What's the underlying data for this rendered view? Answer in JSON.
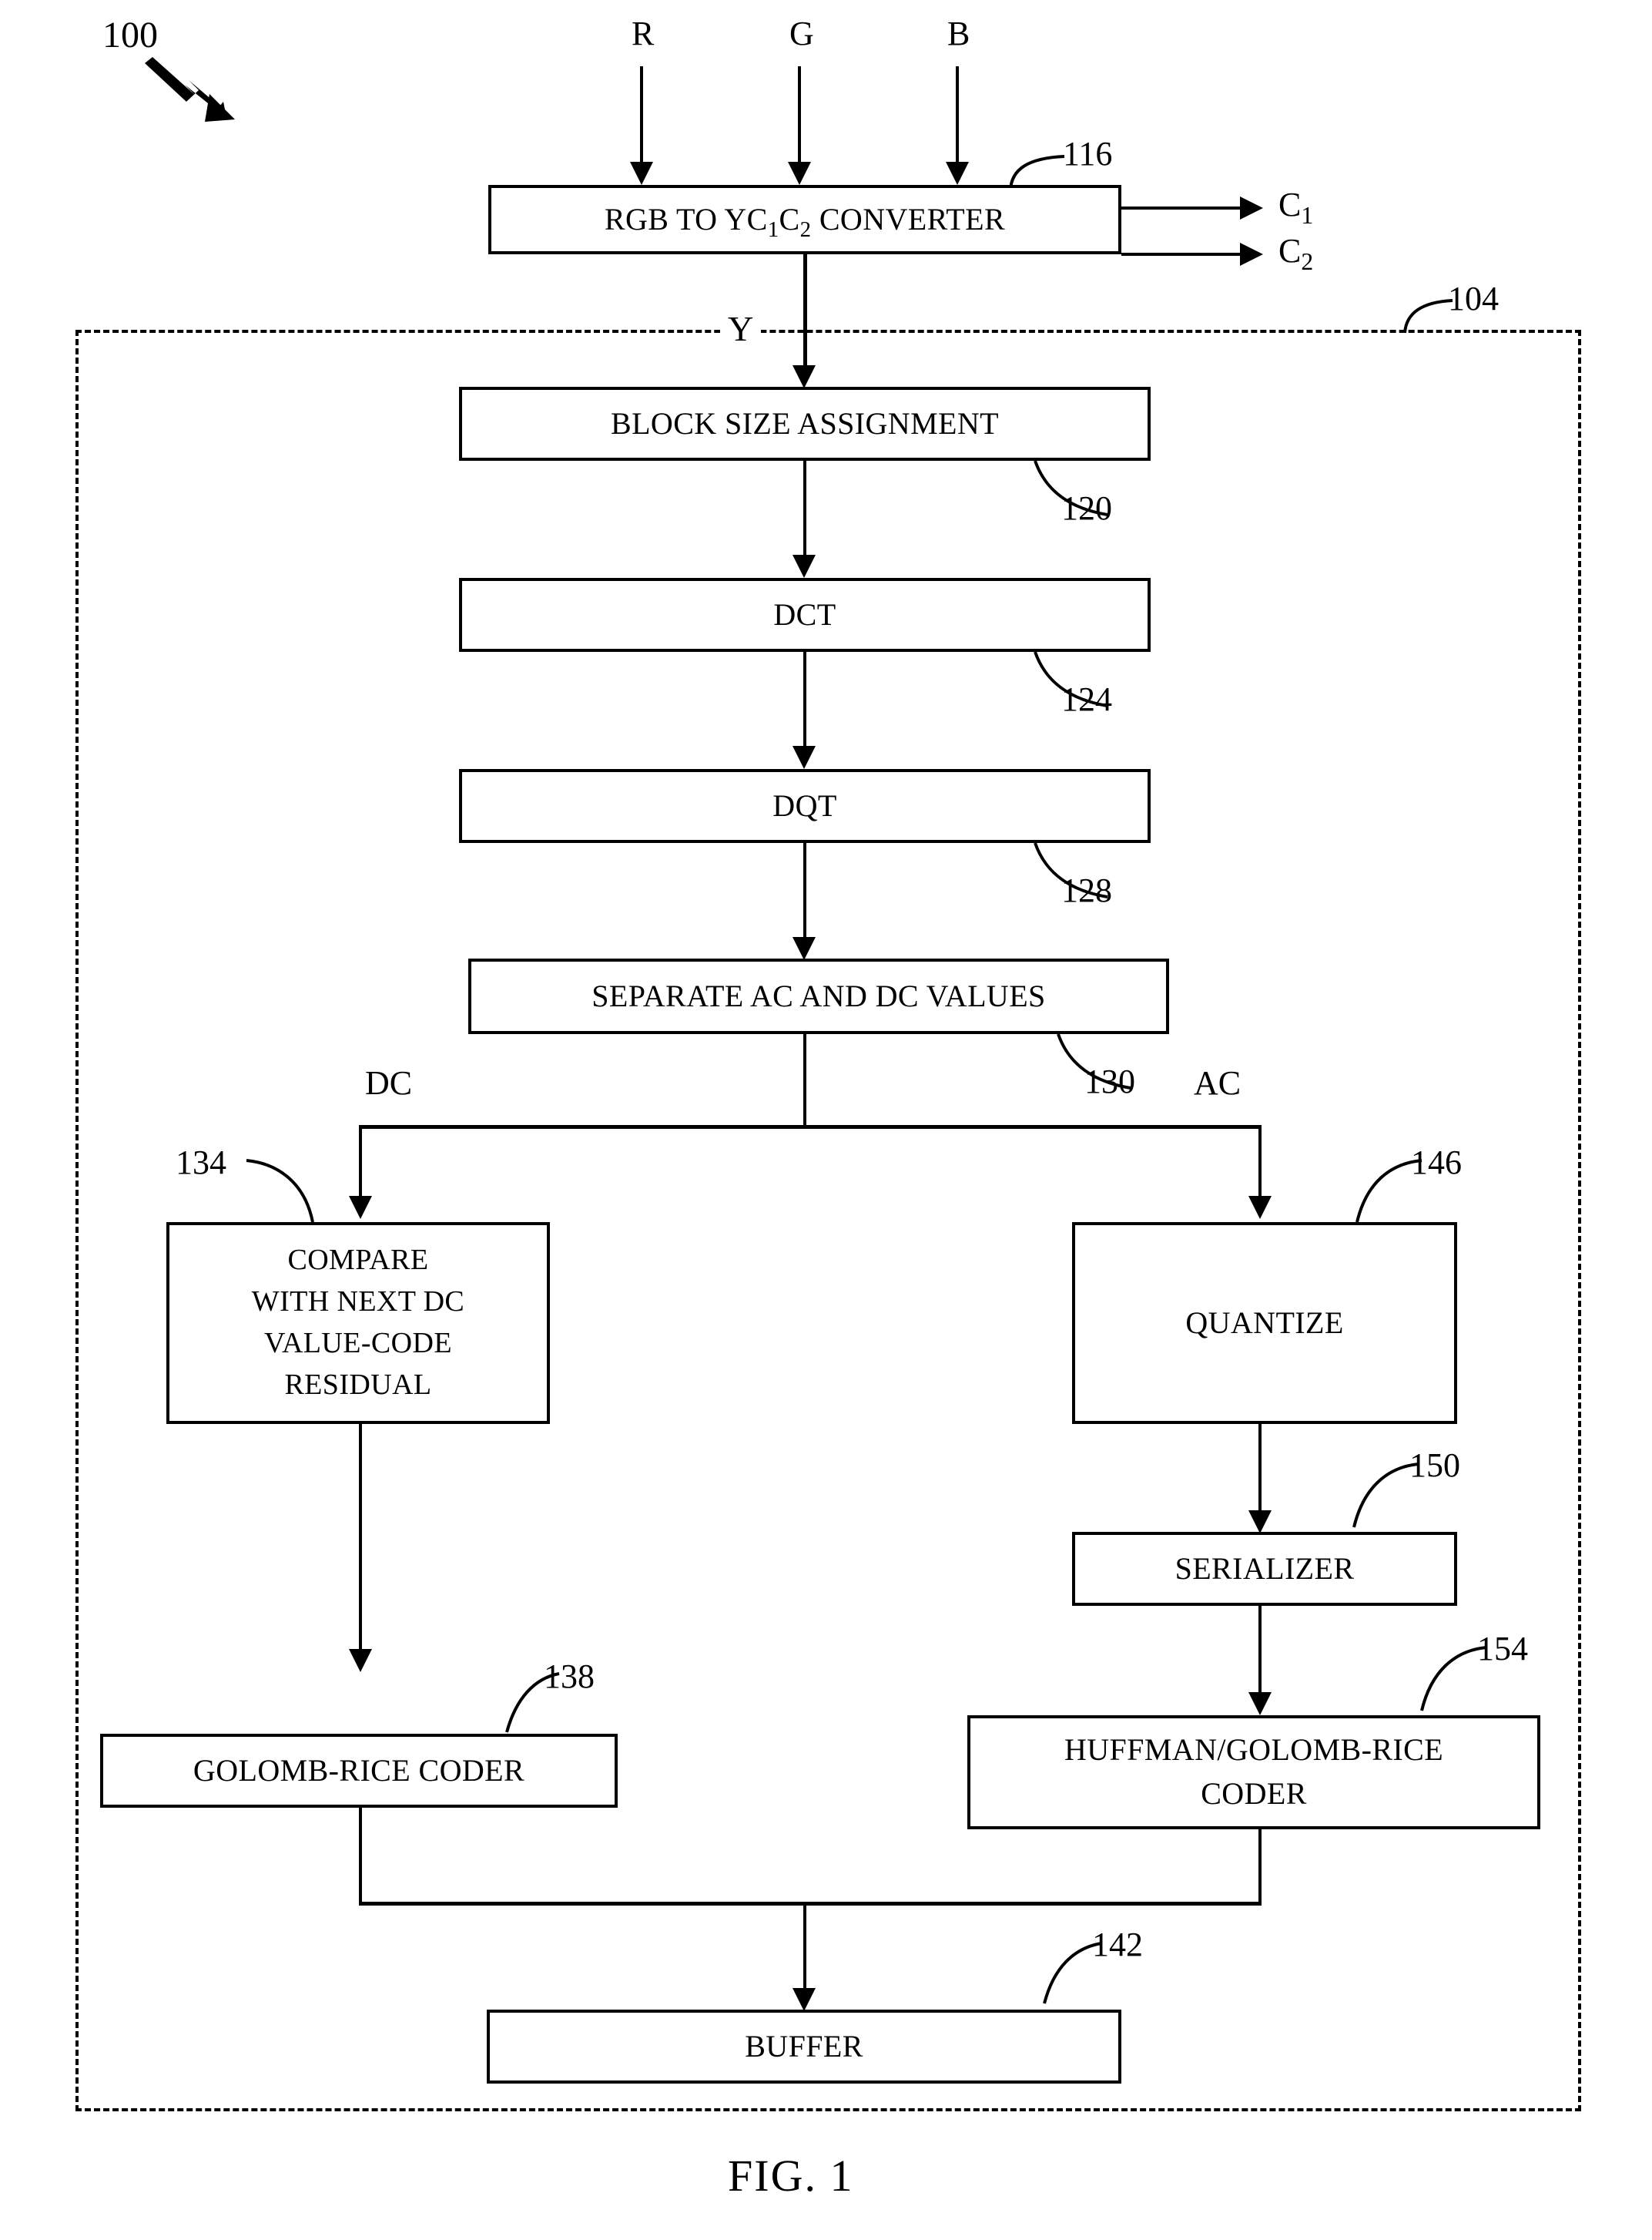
{
  "figure": {
    "caption": "FIG. 1",
    "system_ref": "100",
    "encoder_region_ref": "104"
  },
  "inputs": {
    "r": "R",
    "g": "G",
    "b": "B"
  },
  "outputs": {
    "c1_prefix": "C",
    "c1_sub": "1",
    "c2_prefix": "C",
    "c2_sub": "2"
  },
  "signals": {
    "y": "Y",
    "dc": "DC",
    "ac": "AC"
  },
  "blocks": [
    {
      "id": "converter",
      "label_prefix": "RGB TO YC",
      "label_sub1": "1",
      "label_mid": "C",
      "label_sub2": "2",
      "label_suffix": " CONVERTER",
      "ref": "116"
    },
    {
      "id": "block-size-assignment",
      "label": "BLOCK SIZE ASSIGNMENT",
      "ref": "120"
    },
    {
      "id": "dct",
      "label": "DCT",
      "ref": "124"
    },
    {
      "id": "dqt",
      "label": "DQT",
      "ref": "128"
    },
    {
      "id": "separate-ac-dc",
      "label": "SEPARATE AC AND DC VALUES",
      "ref": "130"
    },
    {
      "id": "compare-next-dc",
      "label": "COMPARE\nWITH NEXT DC\nVALUE-CODE\nRESIDUAL",
      "ref": "134"
    },
    {
      "id": "quantize",
      "label": "QUANTIZE",
      "ref": "146"
    },
    {
      "id": "serializer",
      "label": "SERIALIZER",
      "ref": "150"
    },
    {
      "id": "golomb-rice-coder",
      "label": "GOLOMB-RICE CODER",
      "ref": "138"
    },
    {
      "id": "huffman-golomb-rice-coder",
      "label": "HUFFMAN/GOLOMB-RICE\nCODER",
      "ref": "154"
    },
    {
      "id": "buffer",
      "label": "BUFFER",
      "ref": "142"
    }
  ],
  "colors": {
    "ink": "#000000",
    "paper": "#ffffff"
  }
}
